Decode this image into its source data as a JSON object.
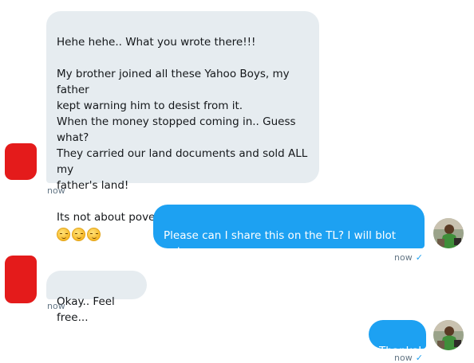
{
  "messages": [
    {
      "text": "Hehe hehe.. What you wrote there!!!\n\nMy brother joined all these Yahoo Boys, my father\nkept warning him to desist from it.\nWhen the money stopped coming in.. Guess what?\nThey carried our land documents and sold ALL my\nfather's land!\n\nIts not about poverty.. It's just living big.",
      "emoji": [
        "smirking-face",
        "smirking-face",
        "smirking-face"
      ],
      "time": "now"
    },
    {
      "text": "Please can I share this on the TL? I will blot out\nyour name and avi.",
      "time": "now",
      "read_mark": "✓"
    },
    {
      "text": "Okay.. Feel free...",
      "time": "now"
    },
    {
      "text": "Thanks!",
      "time": "now",
      "read_mark": "✓"
    }
  ],
  "colors": {
    "received_bubble": "#e6ecf0",
    "sent_bubble": "#1da1f2",
    "redaction": "#e41b1b",
    "timestamp": "#657786"
  }
}
